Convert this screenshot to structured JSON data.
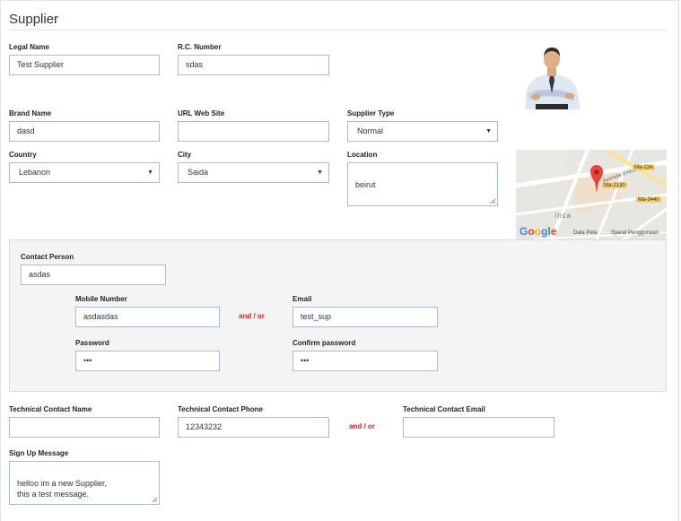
{
  "page": {
    "title": "Supplier"
  },
  "form": {
    "legal_name": {
      "label": "Legal Name",
      "value": "Test Supplier"
    },
    "rc_number": {
      "label": "R.C. Number",
      "value": "sdas"
    },
    "brand_name": {
      "label": "Brand Name",
      "value": "dasd"
    },
    "url_web_site": {
      "label": "URL Web Site",
      "value": ""
    },
    "supplier_type": {
      "label": "Supplier Type",
      "value": "Normal"
    },
    "country": {
      "label": "Country",
      "value": "Lebanon"
    },
    "city": {
      "label": "City",
      "value": "Saida"
    },
    "location": {
      "label": "Location",
      "value": "beirut"
    },
    "contact": {
      "contact_person": {
        "label": "Contact Person",
        "value": "asdas"
      },
      "mobile_number": {
        "label": "Mobile Number",
        "value": "asdasdas"
      },
      "and_or": "and / or",
      "email": {
        "label": "Email",
        "value": "test_sup"
      },
      "password": {
        "label": "Password",
        "value": "•••"
      },
      "confirm_password": {
        "label": "Confirm password",
        "value": "•••"
      }
    },
    "technical_contact_name": {
      "label": "Technical Contact Name",
      "value": ""
    },
    "technical_contact_phone": {
      "label": "Technical Contact Phone",
      "value": "12343232"
    },
    "technical_and_or": "and / or",
    "technical_contact_email": {
      "label": "Technical Contact Email",
      "value": ""
    },
    "signup_message": {
      "label": "Sign Up Message",
      "value": "helloo im a new Supplier,\nthis a test message."
    }
  },
  "map": {
    "logo": "Google",
    "data_link": "Data Peta",
    "terms_link": "Syarat Penggunaan",
    "place_label": "Inca",
    "street_label": "Avenida d'Alcú",
    "road_tags": [
      "Ma-13A",
      "Ma-2130",
      "Ma-3440"
    ],
    "logo_colors": [
      "#4285f4",
      "#ea4335",
      "#fbbc05",
      "#4285f4",
      "#34a853",
      "#ea4335"
    ]
  },
  "icons": {
    "avatar": "businessman-photo",
    "pin": "map-pin-icon",
    "caret": "chevron-down-icon"
  }
}
